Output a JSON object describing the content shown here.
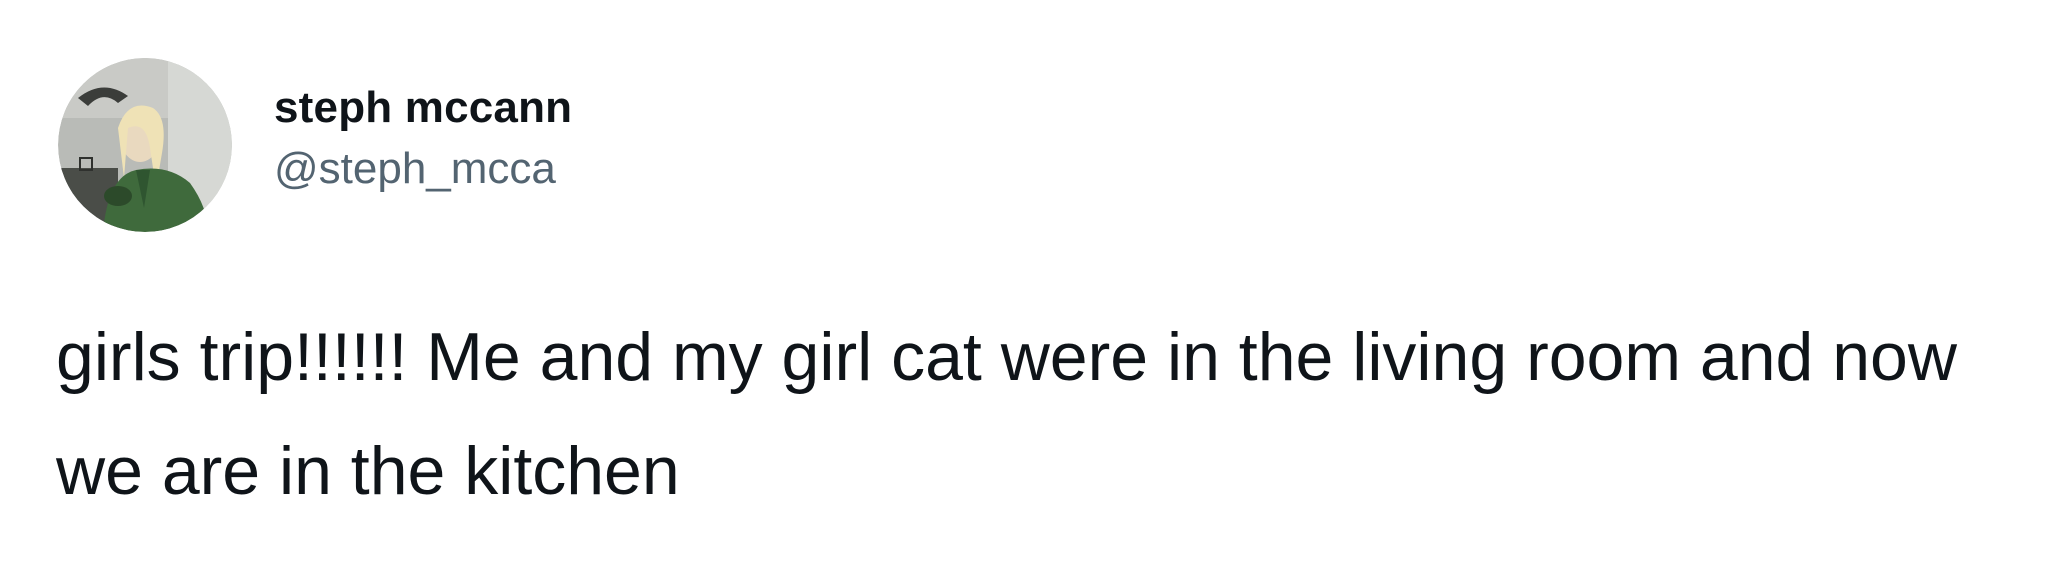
{
  "tweet": {
    "author": {
      "display_name": "steph mccann",
      "handle": "@steph_mcca"
    },
    "text": "girls trip!!!!!! Me and my girl cat were in the living room and now we are in the kitchen"
  }
}
